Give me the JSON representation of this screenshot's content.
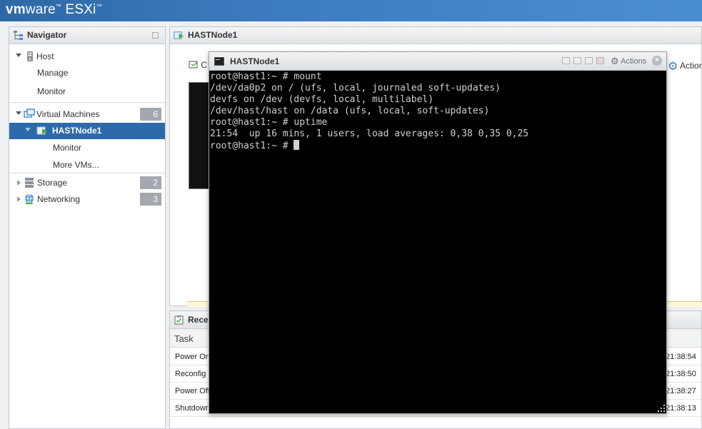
{
  "app": {
    "brand_vm": "vm",
    "brand_ware": "ware",
    "brand_product": "ESXi",
    "brand_mark": "™"
  },
  "navigator": {
    "title": "Navigator",
    "items": [
      {
        "label": "Host",
        "icon": "server-icon"
      },
      {
        "label": "Manage"
      },
      {
        "label": "Monitor"
      },
      {
        "label": "Virtual Machines",
        "icon": "vm-group-icon",
        "count": "6"
      },
      {
        "label": "HASTNode1",
        "icon": "vm-powered-on-icon"
      },
      {
        "label": "Monitor"
      },
      {
        "label": "More VMs..."
      },
      {
        "label": "Storage",
        "icon": "storage-icon",
        "count": "2"
      },
      {
        "label": "Networking",
        "icon": "network-icon",
        "count": "3"
      }
    ]
  },
  "main": {
    "title": "HASTNode1",
    "console_btn_label": "C",
    "actions_label": "Actions"
  },
  "tasks": {
    "title": "Rece",
    "column_task": "Task",
    "rows": [
      {
        "task": "Power On",
        "time": "21:38:54"
      },
      {
        "task": "Reconfig V",
        "time": "21:38:50"
      },
      {
        "task": "Power Off",
        "time": "21:38:27"
      },
      {
        "task": "Shutdown",
        "time": "21:38:13"
      }
    ]
  },
  "console": {
    "title": "HASTNode1",
    "actions_label": "Actions",
    "close_label": "×",
    "lines": [
      "root@hast1:~ # mount",
      "/dev/da0p2 on / (ufs, local, journaled soft-updates)",
      "devfs on /dev (devfs, local, multilabel)",
      "/dev/hast/hast on /data (ufs, local, soft-updates)",
      "root@hast1:~ # uptime",
      "21:54  up 16 mins, 1 users, load averages: 0,38 0,35 0,25"
    ],
    "prompt": "root@hast1:~ # "
  },
  "colors": {
    "selected_bg": "#2d6aab",
    "badge_bg": "#a3a8ae",
    "banner": "#3c7cc0",
    "terminal_bg": "#000000",
    "terminal_fg": "#d0d0d0"
  }
}
